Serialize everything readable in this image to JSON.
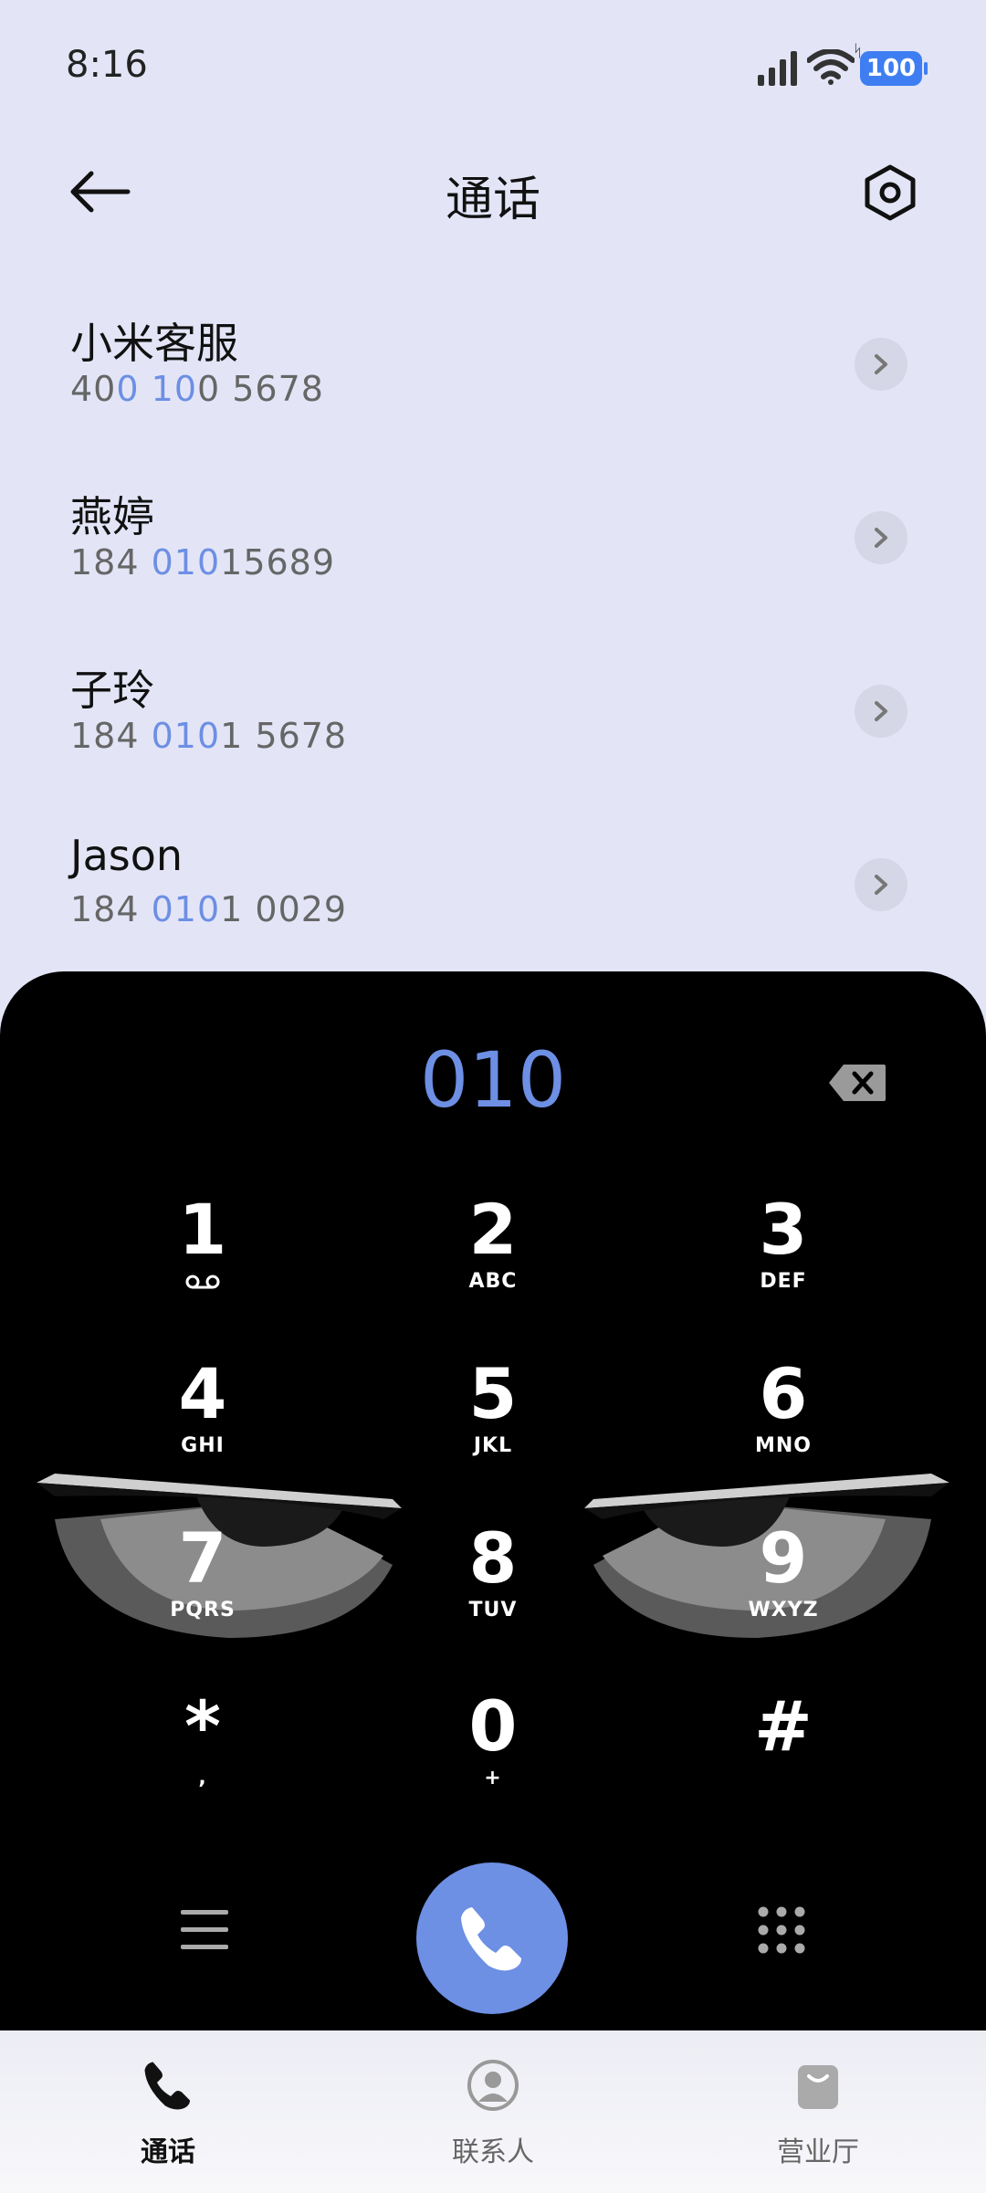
{
  "status_bar": {
    "time": "8:16",
    "battery": "100"
  },
  "header": {
    "title": "通话"
  },
  "contacts": [
    {
      "name": "小米客服",
      "number_parts": [
        "40",
        "0",
        " ",
        "10",
        "0 5678"
      ]
    },
    {
      "name": "燕婷",
      "number_parts": [
        "184 ",
        "010",
        "15689"
      ]
    },
    {
      "name": "子玲",
      "number_parts": [
        "184 ",
        "010",
        "1 5678"
      ]
    },
    {
      "name": "Jason",
      "number_parts": [
        "184 ",
        "010",
        "1 0029"
      ]
    }
  ],
  "dialer": {
    "input": "010",
    "keys": [
      {
        "digit": "1",
        "letters": ""
      },
      {
        "digit": "2",
        "letters": "ABC"
      },
      {
        "digit": "3",
        "letters": "DEF"
      },
      {
        "digit": "4",
        "letters": "GHI"
      },
      {
        "digit": "5",
        "letters": "JKL"
      },
      {
        "digit": "6",
        "letters": "MNO"
      },
      {
        "digit": "7",
        "letters": "PQRS"
      },
      {
        "digit": "8",
        "letters": "TUV"
      },
      {
        "digit": "9",
        "letters": "WXYZ"
      },
      {
        "digit": "*",
        "letters": ","
      },
      {
        "digit": "0",
        "letters": "+"
      },
      {
        "digit": "#",
        "letters": ""
      }
    ],
    "icons": {
      "delete": "backspace-icon",
      "menu": "menu-icon",
      "call": "phone-icon",
      "keypad": "keypad-icon",
      "voicemail": "voicemail-icon"
    },
    "accent_color": "#6d8fe4"
  },
  "bottom_nav": {
    "items": [
      {
        "label": "通话",
        "icon": "phone-icon",
        "active": true
      },
      {
        "label": "联系人",
        "icon": "person-icon",
        "active": false
      },
      {
        "label": "营业厅",
        "icon": "shopping-bag-icon",
        "active": false
      }
    ]
  }
}
